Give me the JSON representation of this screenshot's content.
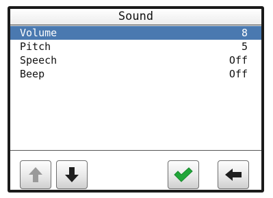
{
  "title": "Sound",
  "menu": {
    "items": [
      {
        "label": "Volume",
        "value": "8"
      },
      {
        "label": "Pitch",
        "value": "5"
      },
      {
        "label": "Speech",
        "value": "Off"
      },
      {
        "label": "Beep",
        "value": "Off"
      }
    ],
    "selected_index": 0
  },
  "toolbar": {
    "buttons": [
      {
        "icon": "arrow-up-icon",
        "enabled": false
      },
      {
        "icon": "arrow-down-icon",
        "enabled": true
      },
      {
        "icon": "checkmark-icon",
        "enabled": true
      },
      {
        "icon": "arrow-left-icon",
        "enabled": true
      }
    ]
  },
  "colors": {
    "selection": "#4a79b0",
    "confirm": "#22a63a",
    "icon": "#1e1e1e",
    "disabled_icon": "#9a9a9a"
  }
}
